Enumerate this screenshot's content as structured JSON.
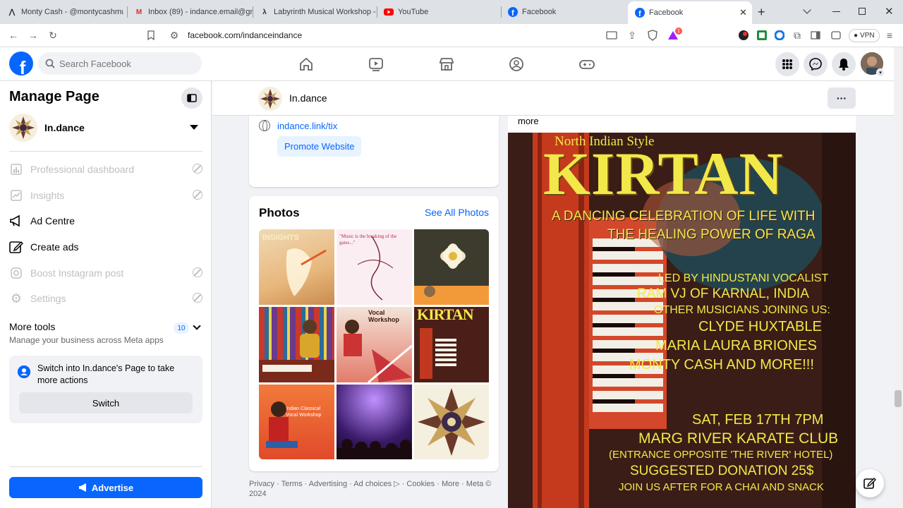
{
  "browser": {
    "tabs": [
      {
        "title": "Monty Cash - @montycashmus",
        "icon": "tiktok-style-icon"
      },
      {
        "title": "Inbox (89) - indance.email@gm",
        "icon": "gmail-icon"
      },
      {
        "title": "Labyrinth Musical Workshop - C",
        "icon": "lambda-icon"
      },
      {
        "title": "YouTube",
        "icon": "youtube-icon"
      },
      {
        "title": "Facebook",
        "icon": "facebook-icon"
      },
      {
        "title": "Facebook",
        "icon": "facebook-icon",
        "active": true
      }
    ],
    "url": "facebook.com/indanceindance",
    "vpn_label": "VPN",
    "brave_badge": "1"
  },
  "fb": {
    "search_placeholder": "Search Facebook"
  },
  "sidebar": {
    "title": "Manage Page",
    "page_name": "In.dance",
    "items": [
      {
        "label": "Professional dashboard",
        "disabled": true
      },
      {
        "label": "Insights",
        "disabled": true
      },
      {
        "label": "Ad Centre",
        "disabled": false
      },
      {
        "label": "Create ads",
        "disabled": false
      },
      {
        "label": "Boost Instagram post",
        "disabled": true
      },
      {
        "label": "Settings",
        "disabled": true
      }
    ],
    "more_tools": {
      "title": "More tools",
      "subtitle": "Manage your business across Meta apps",
      "badge": "10"
    },
    "switch_box": {
      "text": "Switch into In.dance's Page to take more actions",
      "button": "Switch"
    },
    "advertise": "Advertise"
  },
  "page_header": {
    "name": "In.dance"
  },
  "intro": {
    "link": "indance.link/tix",
    "promote": "Promote Website"
  },
  "photos": {
    "title": "Photos",
    "see_all": "See All Photos",
    "thumb_texts": [
      "INSIGHTS",
      "\"Music is the breaking of the gates...\"",
      "",
      "",
      "Vocal Workshop",
      "KIRTAN",
      "Indian Classical Vocal Workshop",
      "",
      ""
    ]
  },
  "footer": {
    "text": "Privacy · Terms · Advertising · Ad choices ▷ · Cookies · More · Meta © 2024"
  },
  "post": {
    "more": "more",
    "poster": {
      "top": "North Indian Style",
      "title": "KIRTAN",
      "subtitle1": "A DANCING CELEBRATION OF LIFE WITH",
      "subtitle2": "THE HEALING POWER OF RAGA",
      "led1": "LED BY HINDUSTANI VOCALIST",
      "led2": "RAM VJ OF KARNAL, INDIA",
      "others": "OTHER MUSICIANS JOINING US:",
      "m1": "CLYDE HUXTABLE",
      "m2": "MARIA LAURA BRIONES",
      "m3": "MONTY CASH AND MORE!!!",
      "date": "SAT, FEB 17TH 7PM",
      "venue": "MARG RIVER KARATE CLUB",
      "entrance": "(ENTRANCE OPPOSITE 'THE RIVER' HOTEL)",
      "donation": "SUGGESTED DONATION 25$",
      "chai": "JOIN US AFTER FOR A CHAI AND SNACK"
    }
  },
  "colors": {
    "fb_blue": "#0866ff",
    "poster_yellow": "#f2e84a",
    "poster_bg": "#3a1d16"
  }
}
